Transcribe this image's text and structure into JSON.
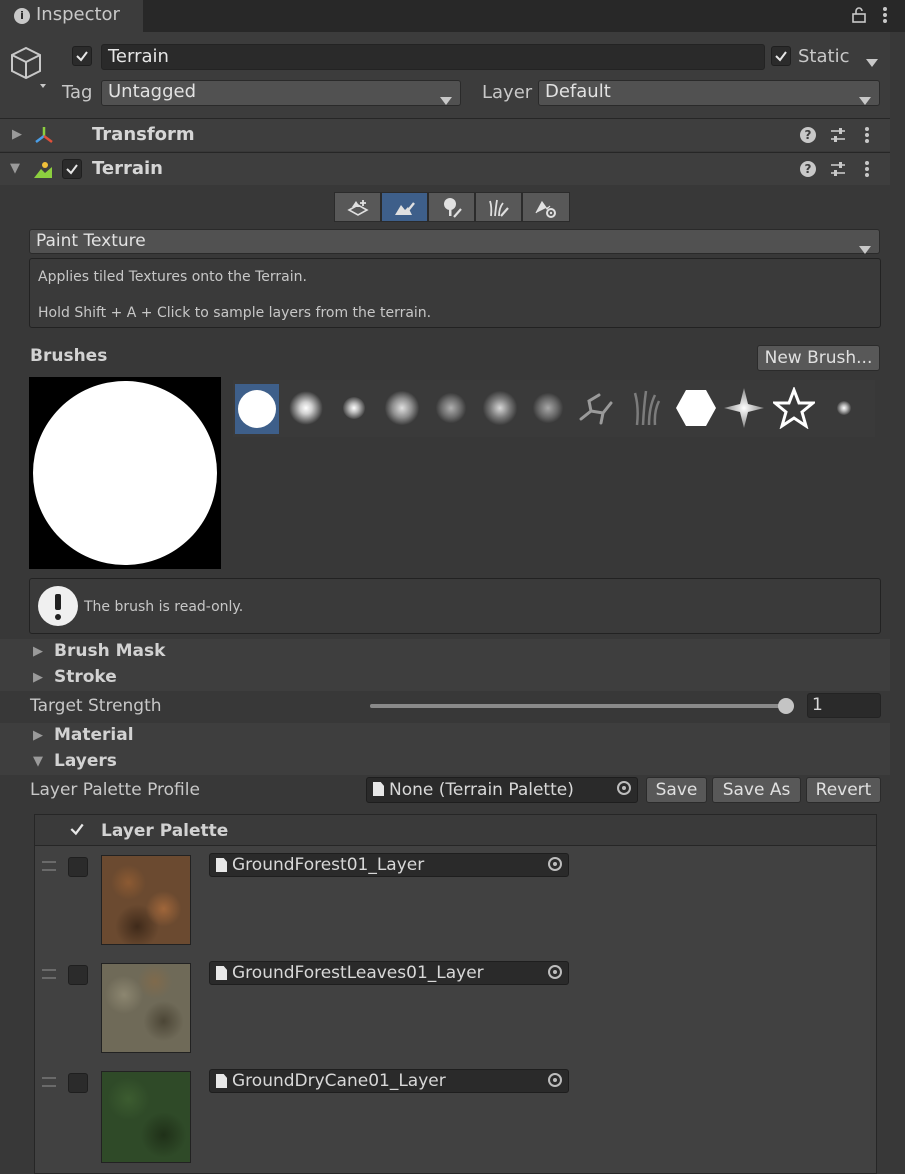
{
  "tab": {
    "title": "Inspector"
  },
  "object": {
    "name": "Terrain",
    "static_label": "Static",
    "tag_label": "Tag",
    "tag_value": "Untagged",
    "layer_label": "Layer",
    "layer_value": "Default",
    "active": true,
    "static": true
  },
  "components": [
    {
      "name": "Transform",
      "expanded": false
    },
    {
      "name": "Terrain",
      "expanded": true,
      "enabled": true
    }
  ],
  "terrain_tools": {
    "tabs": [
      "create-neighbor-terrains-icon",
      "paint-terrain-icon",
      "paint-trees-icon",
      "paint-details-icon",
      "terrain-settings-icon"
    ],
    "selected_tab": 1,
    "mode": "Paint Texture",
    "description_line1": "Applies tiled Textures onto the Terrain.",
    "description_line2": "Hold Shift + A + Click to sample layers from the terrain."
  },
  "brushes": {
    "title": "Brushes",
    "new_brush_label": "New Brush...",
    "readonly_message": "The brush is read-only.",
    "items": [
      "hard-circle",
      "soft-circle",
      "small-soft-dot",
      "cloud-1",
      "cloud-2",
      "cloud-3",
      "cloud-4",
      "crack",
      "grass-strands",
      "hexagon",
      "star-burst",
      "star-outline",
      "tiny-dot"
    ],
    "selected": 0
  },
  "sections": {
    "brush_mask": "Brush Mask",
    "stroke": "Stroke",
    "target_strength_label": "Target Strength",
    "target_strength_value": "1",
    "target_strength_fraction": 1.0,
    "material": "Material",
    "layers": "Layers",
    "palette_profile_label": "Layer Palette Profile",
    "palette_profile_value": "None (Terrain Palette)",
    "save_label": "Save",
    "save_as_label": "Save As",
    "revert_label": "Revert"
  },
  "layer_palette": {
    "title": "Layer Palette",
    "layers": [
      {
        "name": "GroundForest01_Layer",
        "color": "#6b4a30"
      },
      {
        "name": "GroundForestLeaves01_Layer",
        "color": "#6f6a58"
      },
      {
        "name": "GroundDryCane01_Layer",
        "color": "#2f4a28"
      }
    ]
  },
  "colors": {
    "selected": "#3e5f8a",
    "accent": "#8ccf3f"
  }
}
